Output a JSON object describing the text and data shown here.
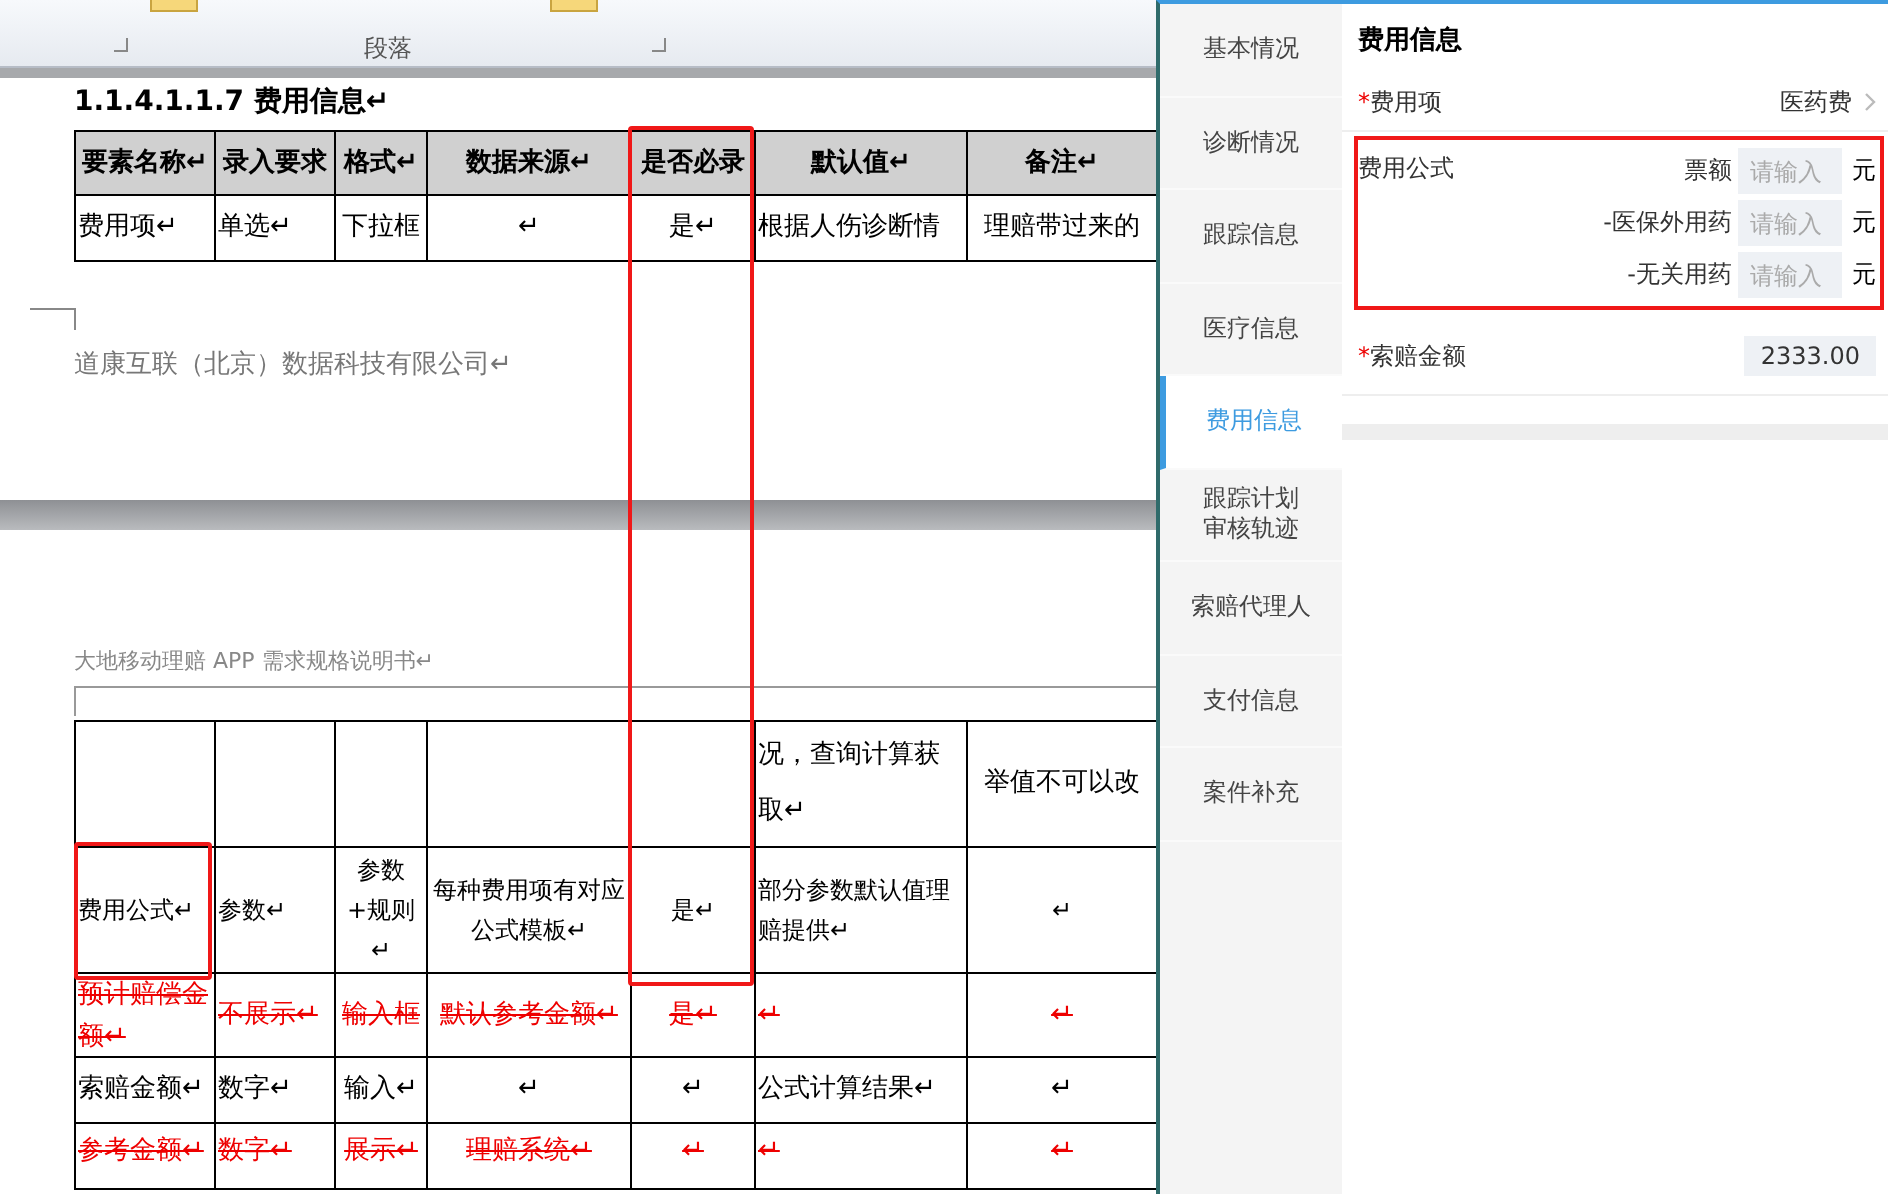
{
  "ribbon": {
    "group_label": "段落"
  },
  "document": {
    "page_1": {
      "heading": "1.1.4.1.1.7  费用信息↵",
      "table": {
        "columns": [
          "要素名称↵",
          "录入要求",
          "格式↵",
          "数据来源↵",
          "是否必录",
          "默认值↵",
          "备注↵"
        ],
        "rows": [
          {
            "kind": "normal",
            "cells": [
              "费用项↵",
              "单选↵",
              "下拉框",
              "↵",
              "是↵",
              "根据人伤诊断情",
              "理赔带过来的"
            ]
          }
        ]
      },
      "footer": "道康互联（北京）数据科技有限公司↵"
    },
    "page_2": {
      "header": "大地移动理赔 APP 需求规格说明书↵",
      "table": {
        "rows": [
          {
            "kind": "normal",
            "cells": [
              "",
              "",
              "",
              "",
              "",
              "况，查询计算获取↵",
              "举值不可以改"
            ]
          },
          {
            "kind": "normal",
            "cells": [
              "费用公式↵",
              "参数↵",
              "参数+规则↵",
              "每种费用项有对应公式模板↵",
              "是↵",
              "部分参数默认值理赔提供↵",
              "↵"
            ]
          },
          {
            "kind": "deleted",
            "cells": [
              "预计赔偿金额↵",
              "不展示↵",
              "输入框",
              "默认参考金额↵",
              "是↵",
              "↵",
              "↵"
            ]
          },
          {
            "kind": "normal",
            "cells": [
              "索赔金额↵",
              "数字↵",
              "输入↵",
              "↵",
              "↵",
              "公式计算结果↵",
              "↵"
            ]
          },
          {
            "kind": "deleted",
            "cells": [
              "参考金额↵",
              "数字↵",
              "展示↵",
              "理赔系统↵",
              "↵",
              "↵",
              "↵"
            ]
          }
        ]
      }
    }
  },
  "app": {
    "sidebar": [
      {
        "label": "基本情况",
        "selected": false
      },
      {
        "label": "诊断情况",
        "selected": false
      },
      {
        "label": "跟踪信息",
        "selected": false
      },
      {
        "label": "医疗信息",
        "selected": false
      },
      {
        "label": "费用信息",
        "selected": true
      },
      {
        "label": "跟踪计划审核轨迹",
        "selected": false
      },
      {
        "label": "索赔代理人",
        "selected": false
      },
      {
        "label": "支付信息",
        "selected": false
      },
      {
        "label": "案件补充",
        "selected": false
      }
    ],
    "form": {
      "title": "费用信息",
      "fields": [
        {
          "kind": "select",
          "marker": "*",
          "label": "费用项",
          "value": "医药费"
        },
        {
          "kind": "formula",
          "label": "费用公式",
          "highlighted": true,
          "items": [
            {
              "label": "票额",
              "placeholder": "请输入",
              "unit": "元"
            },
            {
              "label": "-医保外用药",
              "placeholder": "请输入",
              "unit": "元"
            },
            {
              "label": "-无关用药",
              "placeholder": "请输入",
              "unit": "元"
            }
          ]
        },
        {
          "kind": "amount",
          "marker": "*",
          "label": "索赔金额",
          "value": "2333.00"
        }
      ]
    }
  }
}
